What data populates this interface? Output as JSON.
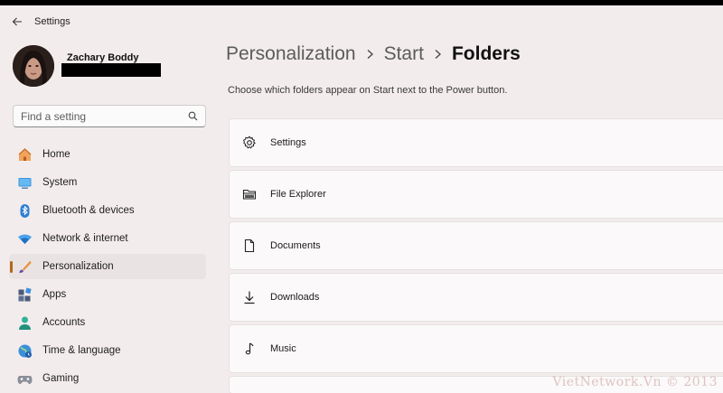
{
  "app": {
    "title": "Settings"
  },
  "profile": {
    "name": "Zachary Boddy"
  },
  "search": {
    "placeholder": "Find a setting"
  },
  "nav": [
    {
      "label": "Home",
      "icon": "home-icon"
    },
    {
      "label": "System",
      "icon": "system-icon"
    },
    {
      "label": "Bluetooth & devices",
      "icon": "bluetooth-icon"
    },
    {
      "label": "Network & internet",
      "icon": "wifi-icon"
    },
    {
      "label": "Personalization",
      "icon": "brush-icon",
      "active": true
    },
    {
      "label": "Apps",
      "icon": "apps-icon"
    },
    {
      "label": "Accounts",
      "icon": "accounts-icon"
    },
    {
      "label": "Time & language",
      "icon": "globe-icon"
    },
    {
      "label": "Gaming",
      "icon": "gamepad-icon"
    }
  ],
  "breadcrumb": [
    "Personalization",
    "Start",
    "Folders"
  ],
  "subtitle": "Choose which folders appear on Start next to the Power button.",
  "folders": [
    {
      "label": "Settings",
      "icon": "gear-icon"
    },
    {
      "label": "File Explorer",
      "icon": "folder-icon"
    },
    {
      "label": "Documents",
      "icon": "document-icon"
    },
    {
      "label": "Downloads",
      "icon": "download-icon"
    },
    {
      "label": "Music",
      "icon": "music-icon"
    }
  ],
  "watermark": "VietNetwork.Vn © 2013",
  "colors": {
    "accent": "#b5651d",
    "background": "#f3ecec",
    "card": "#fbf9f9"
  }
}
